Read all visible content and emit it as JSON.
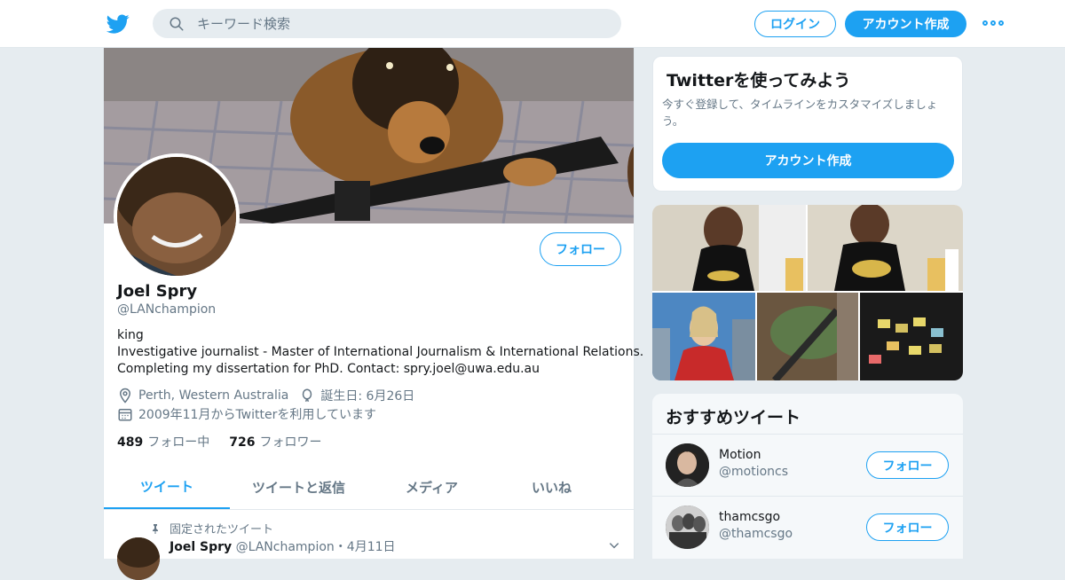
{
  "header": {
    "search_placeholder": "キーワード検索",
    "login_label": "ログイン",
    "signup_label": "アカウント作成"
  },
  "profile": {
    "follow_label": "フォロー",
    "name": "Joel Spry",
    "handle": "@LANchampion",
    "bio_lines": [
      "king",
      "Investigative journalist - Master of International Journalism & International Relations.",
      "Completing my dissertation for PhD. Contact: spry.joel@uwa.edu.au"
    ],
    "location": "Perth, Western Australia",
    "birthday": "誕生日: 6月26日",
    "joined": "2009年11月からTwitterを利用しています",
    "following_count": "489",
    "following_label": "フォロー中",
    "followers_count": "726",
    "followers_label": "フォロワー"
  },
  "tabs": [
    {
      "label": "ツイート",
      "active": true
    },
    {
      "label": "ツイートと返信",
      "active": false
    },
    {
      "label": "メディア",
      "active": false
    },
    {
      "label": "いいね",
      "active": false
    }
  ],
  "pinned_tweet": {
    "pinned_label": "固定されたツイート",
    "name": "Joel Spry",
    "handle": "@LANchampion",
    "separator": "・",
    "date": "4月11日"
  },
  "signup_card": {
    "title": "Twitterを使ってみよう",
    "description": "今すぐ登録して、タイムラインをカスタマイズしましょう。",
    "button_label": "アカウント作成"
  },
  "recommended": {
    "title": "おすすめツイート",
    "follow_label": "フォロー",
    "accounts": [
      {
        "name": "Motion",
        "handle": "@motioncs"
      },
      {
        "name": "thamcsgo",
        "handle": "@thamcsgo"
      }
    ]
  },
  "colors": {
    "accent": "#1da1f2",
    "secondary_text": "#657786",
    "background": "#e6ecf0"
  }
}
